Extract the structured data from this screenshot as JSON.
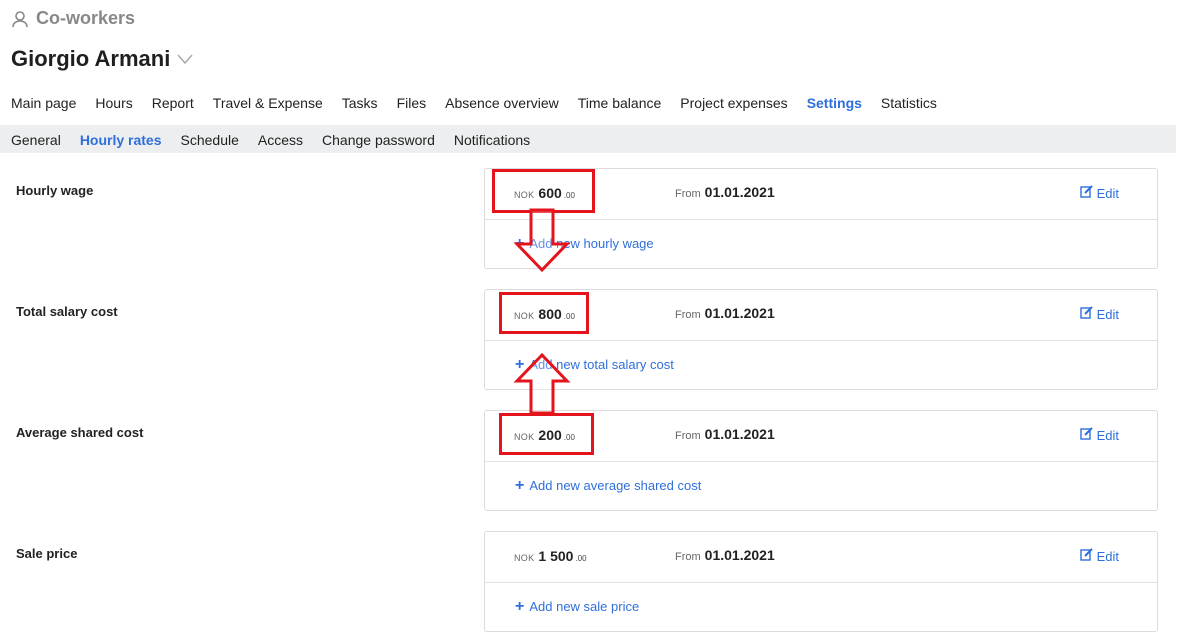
{
  "breadcrumb": {
    "icon": "user-icon",
    "label": "Co-workers"
  },
  "employee": {
    "name": "Giorgio Armani",
    "icon": "chevron-down-icon"
  },
  "main_nav": [
    "Main page",
    "Hours",
    "Report",
    "Travel & Expense",
    "Tasks",
    "Files",
    "Absence overview",
    "Time balance",
    "Project expenses",
    "Settings",
    "Statistics"
  ],
  "main_nav_active": "Settings",
  "sub_nav": [
    "General",
    "Hourly rates",
    "Schedule",
    "Access",
    "Change password",
    "Notifications"
  ],
  "sub_nav_active": "Hourly rates",
  "sections": [
    {
      "label": "Hourly wage",
      "currency": "NOK",
      "amount": "600",
      "decimals": ".00",
      "from_label": "From",
      "from_date": "01.01.2021",
      "edit_label": "Edit",
      "add_label": "Add new hourly wage"
    },
    {
      "label": "Total salary cost",
      "currency": "NOK",
      "amount": "800",
      "decimals": ".00",
      "from_label": "From",
      "from_date": "01.01.2021",
      "edit_label": "Edit",
      "add_label": "Add new total salary cost"
    },
    {
      "label": "Average shared cost",
      "currency": "NOK",
      "amount": "200",
      "decimals": ".00",
      "from_label": "From",
      "from_date": "01.01.2021",
      "edit_label": "Edit",
      "add_label": "Add new average shared cost"
    },
    {
      "label": "Sale price",
      "currency": "NOK",
      "amount": "1 500",
      "decimals": ".00",
      "from_label": "From",
      "from_date": "01.01.2021",
      "edit_label": "Edit",
      "add_label": "Add new sale price"
    }
  ],
  "colors": {
    "accent": "#2f6fdc",
    "annotation": "#e3141b",
    "subnav_bg": "#eceeef"
  }
}
